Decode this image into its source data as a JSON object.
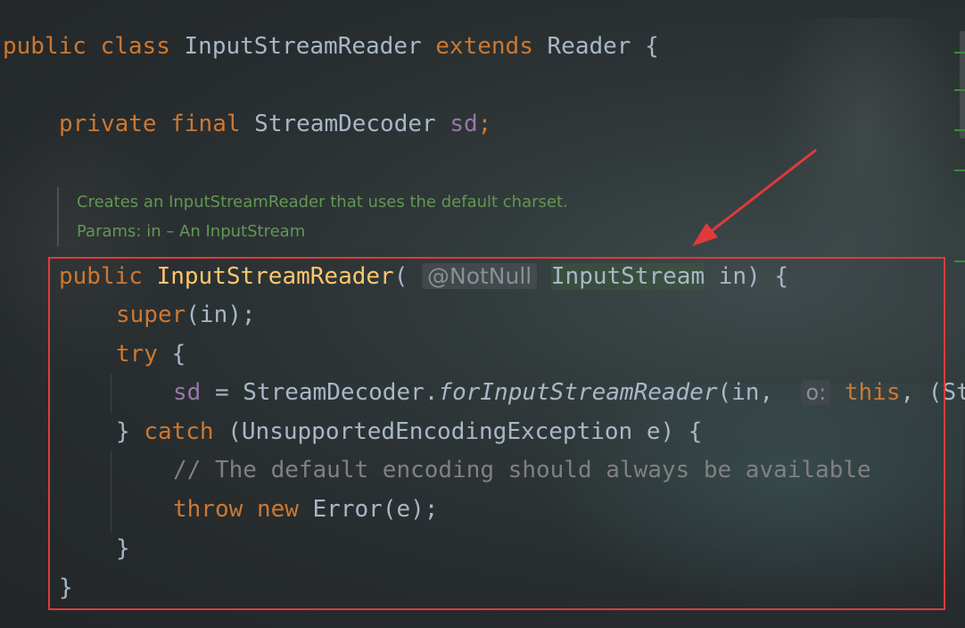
{
  "code": {
    "class_decl": {
      "kw1": "public",
      "kw2": "class",
      "name": "InputStreamReader",
      "kw3": "extends",
      "parent": "Reader",
      "brace": "{"
    },
    "field_decl": {
      "kw1": "private",
      "kw2": "final",
      "type": "StreamDecoder",
      "name": "sd",
      "semi": ";"
    },
    "doc": {
      "line1": "Creates an InputStreamReader that uses the default charset.",
      "line2": "Params: in – An InputStream"
    },
    "ctor": {
      "kw": "public",
      "name": "InputStreamReader",
      "open": "(",
      "annotation": "@NotNull",
      "type": "InputStream",
      "rest": " in) {"
    },
    "super_call": {
      "kw": "super",
      "rest": "(in);"
    },
    "try_line": {
      "kw": "try",
      "rest": " {"
    },
    "assign_line": {
      "field": "sd",
      "eq": " = StreamDecoder.",
      "method": "forInputStreamReader",
      "args": "(in, ",
      "hint": "o:",
      "this_kw": "this",
      "tail": ", (St"
    },
    "catch_line": {
      "pre": "} ",
      "kw": "catch",
      "rest": " (UnsupportedEncodingException e) {"
    },
    "comment_line": "// The default encoding should always be available",
    "throw_line": {
      "kw1": "throw",
      "kw2": "new",
      "rest": " Error(e);"
    },
    "close_inner": "}",
    "close_outer": "}"
  },
  "highlight_color": "#e03a3a"
}
